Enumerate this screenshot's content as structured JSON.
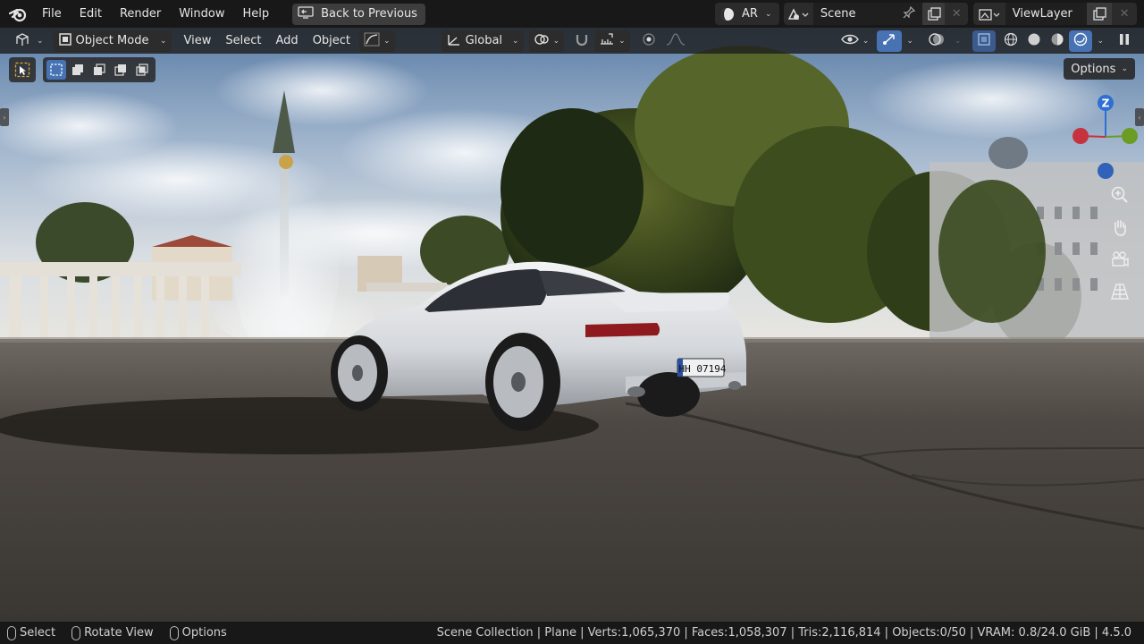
{
  "menu": {
    "items": [
      "File",
      "Edit",
      "Render",
      "Window",
      "Help"
    ],
    "back_button": "Back to Previous"
  },
  "workspace": {
    "ar_label": "AR",
    "scene_name": "Scene",
    "view_layer": "ViewLayer"
  },
  "viewport_header": {
    "mode": "Object Mode",
    "menus": [
      "View",
      "Select",
      "Add",
      "Object"
    ],
    "transform_orientation": "Global"
  },
  "tool_settings": {
    "options_label": "Options"
  },
  "gizmo": {
    "z_label": "Z",
    "colors": {
      "x": "#c7323f",
      "y": "#6b9c24",
      "z": "#2f6fd3"
    }
  },
  "statusbar": {
    "hints": [
      {
        "icon": "mouse-left-icon",
        "label": "Select"
      },
      {
        "icon": "mouse-middle-icon",
        "label": "Rotate View"
      },
      {
        "icon": "mouse-right-icon",
        "label": "Options"
      }
    ],
    "stats": "Scene Collection | Plane | Verts:1,065,370 | Faces:1,058,307 | Tris:2,116,814 | Objects:0/50 | VRAM: 0.8/24.0 GiB | 4.5.0"
  },
  "plate": {
    "text": "HH 07194"
  },
  "colors": {
    "accent": "#4772b3",
    "topbar": "#181818",
    "panel": "#2b2b2b"
  }
}
